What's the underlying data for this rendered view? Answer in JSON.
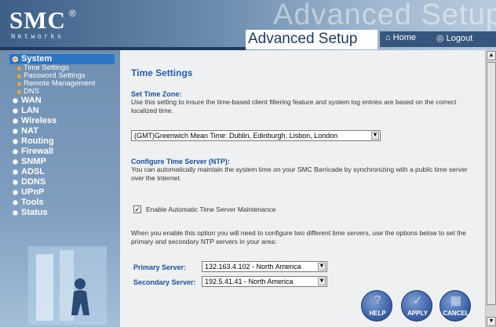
{
  "header": {
    "logo_text": "SMC",
    "logo_reg": "®",
    "logo_sub": "Networks",
    "ghost_text": "Advanced Setup",
    "title": "Advanced Setup",
    "home_label": "Home",
    "logout_label": "Logout"
  },
  "sidebar": {
    "items": [
      {
        "label": "System",
        "active": true
      },
      {
        "label": "WAN"
      },
      {
        "label": "LAN"
      },
      {
        "label": "Wireless"
      },
      {
        "label": "NAT"
      },
      {
        "label": "Routing"
      },
      {
        "label": "Firewall"
      },
      {
        "label": "SNMP"
      },
      {
        "label": "ADSL"
      },
      {
        "label": "DDNS"
      },
      {
        "label": "UPnP"
      },
      {
        "label": "Tools"
      },
      {
        "label": "Status"
      }
    ],
    "system_sub": [
      {
        "label": "Time Settings"
      },
      {
        "label": "Password Settings"
      },
      {
        "label": "Remote Management"
      },
      {
        "label": "DNS"
      }
    ]
  },
  "content": {
    "page_title": "Time Settings",
    "timezone_heading": "Set Time Zone:",
    "timezone_desc": "Use this setting to insure the time-based client filtering feature and system log entries are based on the correct localized time.",
    "timezone_value": "(GMT)Greenwich Mean Time: Dublin, Edinburgh, Lisbon, London",
    "ntp_heading": "Configure Time Server (NTP):",
    "ntp_desc": "You can automatically maintain the system time on your SMC Barricade by synchronizing with a public time server over the Internet.",
    "enable_ntp_label": "Enable Automatic Time Server Maintenance",
    "enable_ntp_checked": true,
    "servers_desc": "When you enable this option you will need to configure two different time servers, use the options below to set the primary and secondary NTP servers in your area:",
    "primary_label": "Primary Server:",
    "primary_value": "132.163.4.102 - North America",
    "secondary_label": "Secondary Server:",
    "secondary_value": "192.5.41.41 - North America",
    "help_label": "HELP",
    "apply_label": "APPLY",
    "cancel_label": "CANCEL"
  }
}
